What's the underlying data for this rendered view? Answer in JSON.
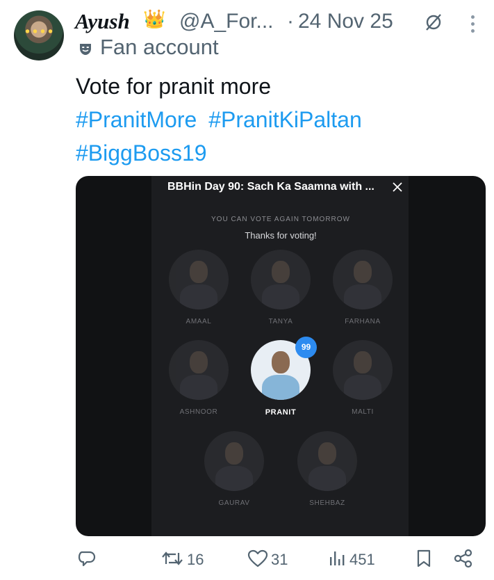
{
  "author": {
    "display_name": "Ayush",
    "handle": "@A_For...",
    "separator": "·",
    "date": "24 Nov 25",
    "label": "Fan account"
  },
  "tweet": {
    "text": "Vote for pranit more",
    "hashtags": [
      "#PranitMore",
      "#PranitKiPaltan",
      "#BiggBoss19"
    ]
  },
  "media": {
    "poll_title": "BBHin Day 90: Sach Ka Saamna with ...",
    "status": "YOU CAN VOTE AGAIN TOMORROW",
    "thanks": "Thanks for voting!",
    "vote_count_badge": "99",
    "candidates": [
      {
        "name": "AMAAL",
        "selected": false
      },
      {
        "name": "TANYA",
        "selected": false
      },
      {
        "name": "FARHANA",
        "selected": false
      },
      {
        "name": "ASHNOOR",
        "selected": false
      },
      {
        "name": "PRANIT",
        "selected": true
      },
      {
        "name": "MALTI",
        "selected": false
      },
      {
        "name": "GAURAV",
        "selected": false
      },
      {
        "name": "SHEHBAZ",
        "selected": false
      }
    ]
  },
  "actions": {
    "reply_count": "",
    "retweet_count": "16",
    "like_count": "31",
    "view_count": "451"
  },
  "colors": {
    "link": "#1d9bf0",
    "secondary_text": "#536471",
    "badge": "#2d8bf0"
  },
  "icons": [
    "crown-emoji",
    "no-entry-icon",
    "more-icon",
    "mask-icon",
    "close-icon",
    "reply-icon",
    "retweet-icon",
    "like-icon",
    "views-icon",
    "bookmark-icon",
    "share-icon"
  ]
}
